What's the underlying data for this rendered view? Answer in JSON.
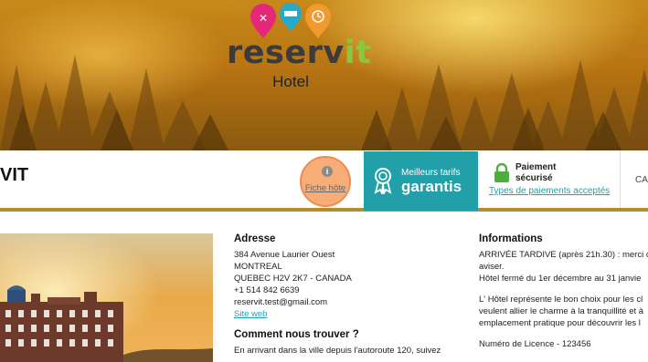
{
  "brand": {
    "logo_main": "reserv",
    "logo_accent": "it",
    "subtitle": "Hotel"
  },
  "bar": {
    "title": "VIT",
    "fiche_label": "Fiche hôte",
    "tarifs_small": "Meilleurs tarifs",
    "tarifs_big": "garantis",
    "pay_title_1": "Paiement",
    "pay_title_2": "sécurisé",
    "pay_link": "Types de paiements acceptés",
    "cart_label": "CA"
  },
  "address": {
    "heading": "Adresse",
    "lines": [
      "384 Avenue Laurier Ouest",
      "MONTREAL",
      "QUEBEC H2V 2K7 - CANADA",
      "+1 514 842 6639",
      "reservit.test@gmail.com"
    ],
    "site_link": "Site web"
  },
  "directions": {
    "heading": "Comment nous trouver ?",
    "text": "En arrivant dans la ville depuis l'autoroute 120, suivez"
  },
  "info": {
    "heading": "Informations",
    "lines": [
      "ARRIVÉE TARDIVE (après 21h.30) : merci c",
      "aviser.",
      "Hôtel fermé du 1er décembre au 31 janvie"
    ],
    "para2": [
      "L' Hôtel représente le bon choix pour les cl",
      "veulent allier le charme à la tranquillité et à",
      "emplacement pratique pour découvrir les l"
    ],
    "licence": "Numéro de Licence - 123456"
  },
  "colors": {
    "teal": "#22a0a9",
    "gold_border": "#b38c2b",
    "lime": "#8cc63e",
    "pin_pink": "#e6287a",
    "pin_teal": "#27a9c7",
    "pin_orange": "#f29a2e"
  }
}
